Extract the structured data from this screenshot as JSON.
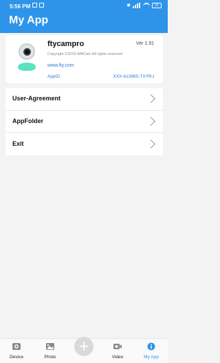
{
  "status_bar": {
    "time": "5:56 PM",
    "battery": "51"
  },
  "header": {
    "title": "My App"
  },
  "app_info": {
    "name": "ftycampro",
    "version": "Ver  1.91",
    "copyright": "Copyright ©2019 WifiCam All rights reserved",
    "website": "www.fty.com",
    "appid_label": "AppID:",
    "appid_value": "XXX-613965-TXYRJ"
  },
  "menu": {
    "user_agreement": "User-Agreement",
    "app_folder": "AppFolder",
    "exit": "Exit"
  },
  "tabs": {
    "device": "Device",
    "photo": "Photo",
    "add": "+",
    "video": "Video",
    "my_app": "My App"
  },
  "colors": {
    "accent": "#2e94ea",
    "logo_base": "#5ce2c3"
  }
}
